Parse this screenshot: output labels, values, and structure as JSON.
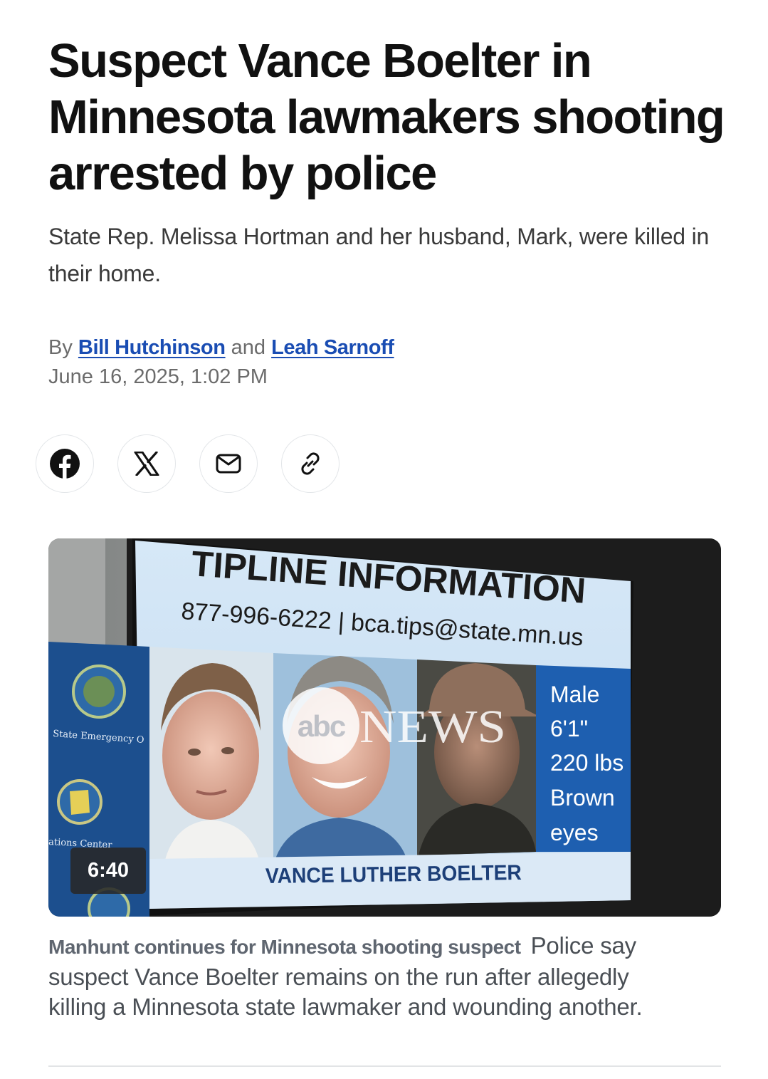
{
  "article": {
    "headline": "Suspect Vance Boelter in Minnesota lawmakers shooting arrested by police",
    "dek": "State Rep. Melissa Hortman and her husband, Mark, were killed in their home.",
    "byline_prefix": "By",
    "author_1": "Bill Hutchinson",
    "byline_and": "and",
    "author_2": "Leah Sarnoff",
    "date": "June 16, 2025, 1:02 PM"
  },
  "share": [
    {
      "name": "facebook-share-button",
      "icon": "facebook-icon"
    },
    {
      "name": "x-share-button",
      "icon": "x-icon"
    },
    {
      "name": "email-share-button",
      "icon": "mail-icon"
    },
    {
      "name": "copy-link-button",
      "icon": "link-icon"
    }
  ],
  "video": {
    "duration": "6:40",
    "screen": {
      "title": "TIPLINE INFORMATION",
      "contact": "877-996-6222 | bca.tips@state.mn.us",
      "stats": [
        "Male",
        "6'1\"",
        "220 lbs",
        "Brown",
        "eyes"
      ],
      "name": "VANCE LUTHER BOELTER"
    },
    "side_banner_text_1": "State Emergency O",
    "side_banner_text_2": "ations Center",
    "watermark": "NEWS",
    "watermark_logo": "abc"
  },
  "caption": {
    "title": "Manhunt continues for Minnesota shooting suspect",
    "text": "Police say suspect Vance Boelter remains on the run after allegedly killing a Minnesota state lawmaker and wounding another."
  },
  "colors": {
    "link": "#1a4db3",
    "screen_blue": "#1e5fb0",
    "text_muted": "#6b6b6b"
  }
}
